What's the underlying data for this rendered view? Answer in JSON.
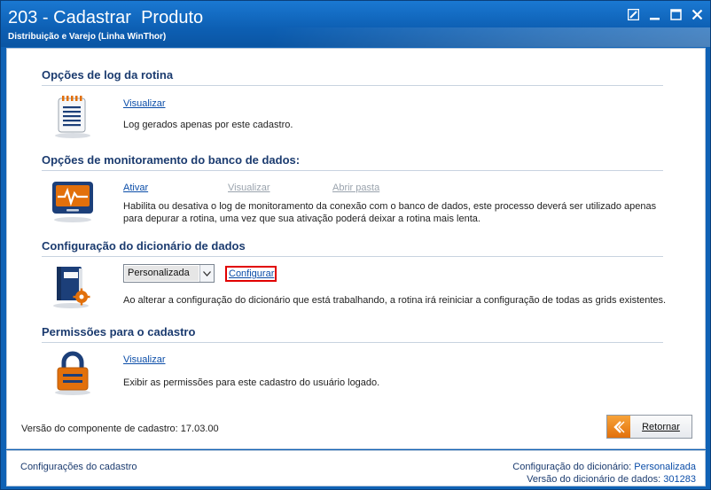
{
  "window": {
    "title": "203 - Cadastrar  Produto",
    "subtitle": "Distribuição e Varejo (Linha WinThor)"
  },
  "sections": {
    "log": {
      "title": "Opções de log da rotina",
      "link_visualizar": "Visualizar",
      "description": "Log gerados apenas por este cadastro."
    },
    "monitor": {
      "title": "Opções de monitoramento do banco de dados:",
      "link_ativar": "Ativar",
      "link_visualizar": "Visualizar",
      "link_abrir_pasta": "Abrir pasta",
      "description_line1": "Habilita ou desativa o log de monitoramento da conexão com o banco de dados, este processo deverá ser utilizado apenas",
      "description_line2": "para depurar a rotina, uma vez que sua ativação poderá deixar a rotina mais lenta."
    },
    "dicionario": {
      "title": "Configuração do dicionário de dados",
      "select_value": "Personalizada",
      "link_configurar": "Configurar",
      "description": "Ao alterar a configuração do dicionário que está trabalhando, a rotina irá reiniciar a configuração de todas as grids existentes."
    },
    "permissoes": {
      "title": "Permissões para o cadastro",
      "link_visualizar": "Visualizar",
      "description": "Exibir as permissões para este cadastro do usuário logado."
    }
  },
  "footer": {
    "version_text": "Versão do componente de cadastro: 17.03.00",
    "retornar_label": "Retornar"
  },
  "statusbar": {
    "left": "Configurações do cadastro",
    "dict_config_label": "Configuração do dicionário:",
    "dict_config_value": "Personalizada",
    "dict_version_label": "Versão do dicionário de dados:",
    "dict_version_value": "301283"
  },
  "colors": {
    "titlebar": "#0d5fb3",
    "section_title": "#1b3b6f",
    "link": "#0b4da8",
    "highlight": "#e10000",
    "accent_orange": "#e2700b"
  },
  "icons": [
    "notepad-icon",
    "monitor-pulse-icon",
    "book-gear-icon",
    "padlock-icon",
    "back-arrow-icon"
  ]
}
